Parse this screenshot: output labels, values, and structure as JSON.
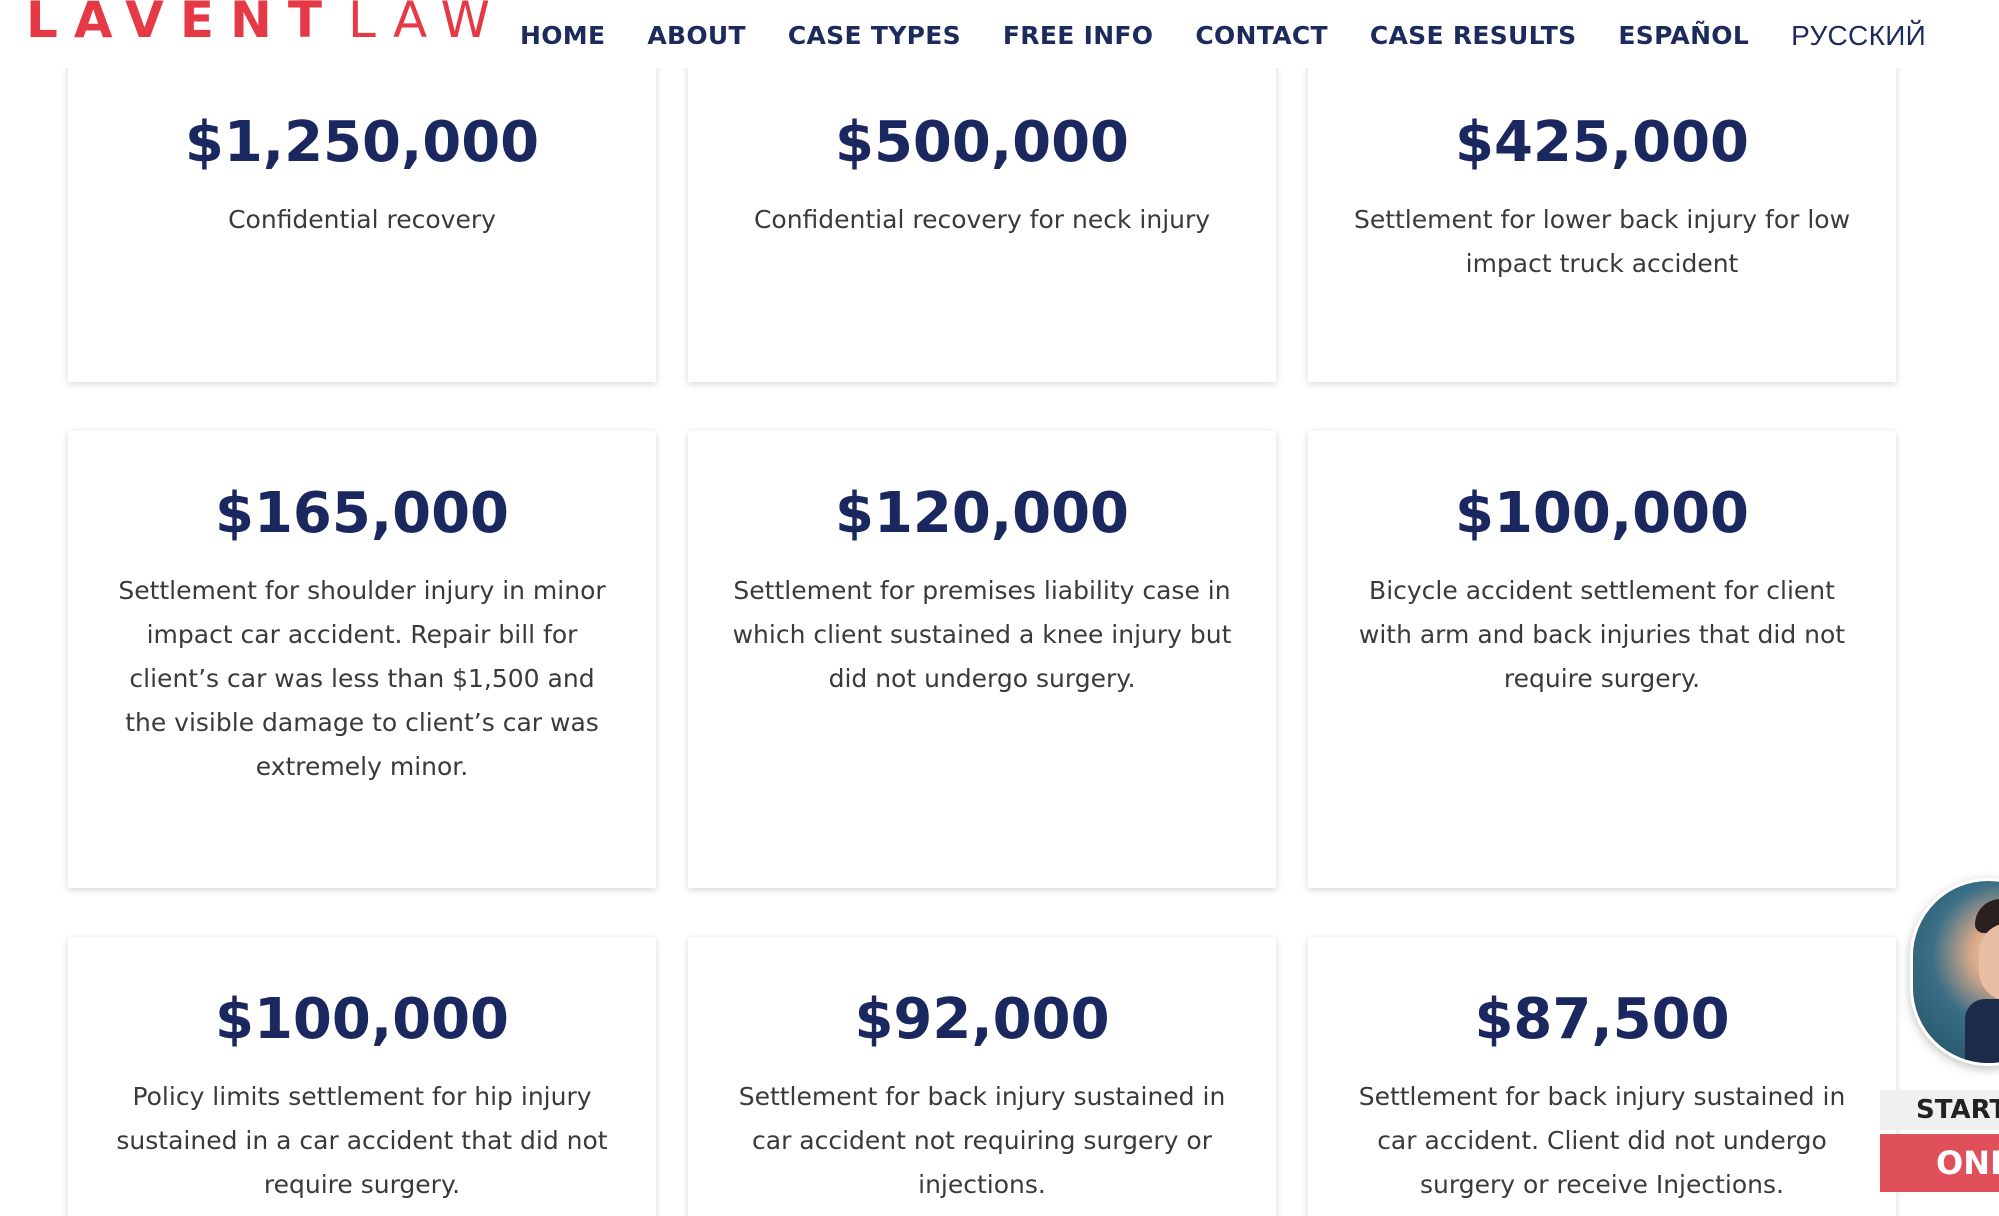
{
  "header": {
    "logo_bold": "LAVENT",
    "logo_light": "LAW",
    "nav": [
      {
        "label": "HOME"
      },
      {
        "label": "ABOUT"
      },
      {
        "label": "CASE TYPES"
      },
      {
        "label": "FREE INFO"
      },
      {
        "label": "CONTACT"
      },
      {
        "label": "CASE RESULTS"
      },
      {
        "label": "ESPAÑOL"
      },
      {
        "label": "РУССКИЙ"
      }
    ]
  },
  "results": [
    {
      "amount": "$1,250,000",
      "description": "Confidential recovery"
    },
    {
      "amount": "$500,000",
      "description": "Confidential recovery for neck injury"
    },
    {
      "amount": "$425,000",
      "description": "Settlement for lower back injury for low impact truck accident"
    },
    {
      "amount": "$165,000",
      "description": "Settlement for shoulder injury in minor impact car accident. Repair bill for client’s car was less than $1,500 and the visible damage to client’s car was extremely minor."
    },
    {
      "amount": "$120,000",
      "description": "Settlement for premises liability case in which client sustained a knee injury but did not undergo surgery."
    },
    {
      "amount": "$100,000",
      "description": "Bicycle accident settlement for client with arm and back injuries that did not require surgery."
    },
    {
      "amount": "$100,000",
      "description": "Policy limits settlement for hip injury sustained in a car accident that did not require surgery."
    },
    {
      "amount": "$92,000",
      "description": "Settlement for back injury sustained in car accident not requiring surgery or injections."
    },
    {
      "amount": "$87,500",
      "description": "Settlement for back injury sustained in car accident. Client did not undergo surgery or receive Injections."
    }
  ],
  "chat_widget": {
    "start_label": "START",
    "online_label": "ONL"
  },
  "colors": {
    "brand_red": "#e63946",
    "navy": "#1b2860",
    "widget_red": "#e0505b"
  }
}
